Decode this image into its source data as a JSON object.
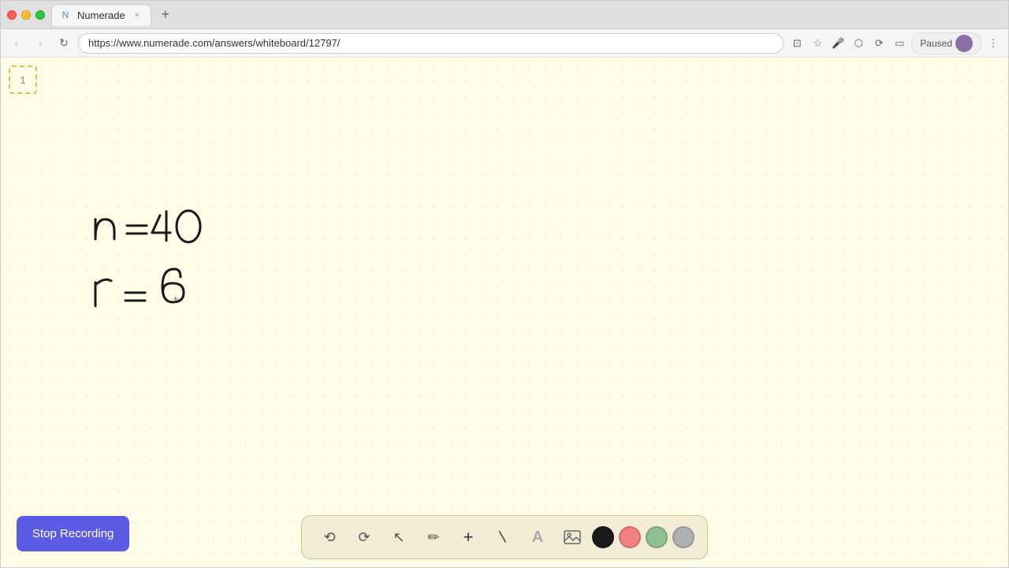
{
  "browser": {
    "title": "Numerade",
    "url": "https://www.numerade.com/answers/whiteboard/12797/",
    "tab_close": "×",
    "tab_new": "+",
    "nav_back": "‹",
    "nav_forward": "›",
    "nav_refresh": "↻",
    "paused_label": "Paused",
    "favicon": "N"
  },
  "page_indicator": "1",
  "toolbar": {
    "undo_label": "⟲",
    "redo_label": "⟳",
    "select_label": "↖",
    "pen_label": "✏",
    "add_label": "+",
    "eraser_label": "/",
    "text_label": "A",
    "image_label": "🖼",
    "color_black": "#1a1a1a",
    "color_pink": "#f08080",
    "color_green": "#90c090",
    "color_gray": "#b0b0b0"
  },
  "stop_recording": {
    "label": "Stop Recording"
  },
  "math_lines": [
    {
      "text": "n = 40"
    },
    {
      "text": "r = 6"
    }
  ],
  "colors": {
    "whiteboard_bg": "#fdfde8",
    "toolbar_bg": "rgba(240,235,210,0.95)",
    "stop_btn_bg": "#5b5be6"
  }
}
